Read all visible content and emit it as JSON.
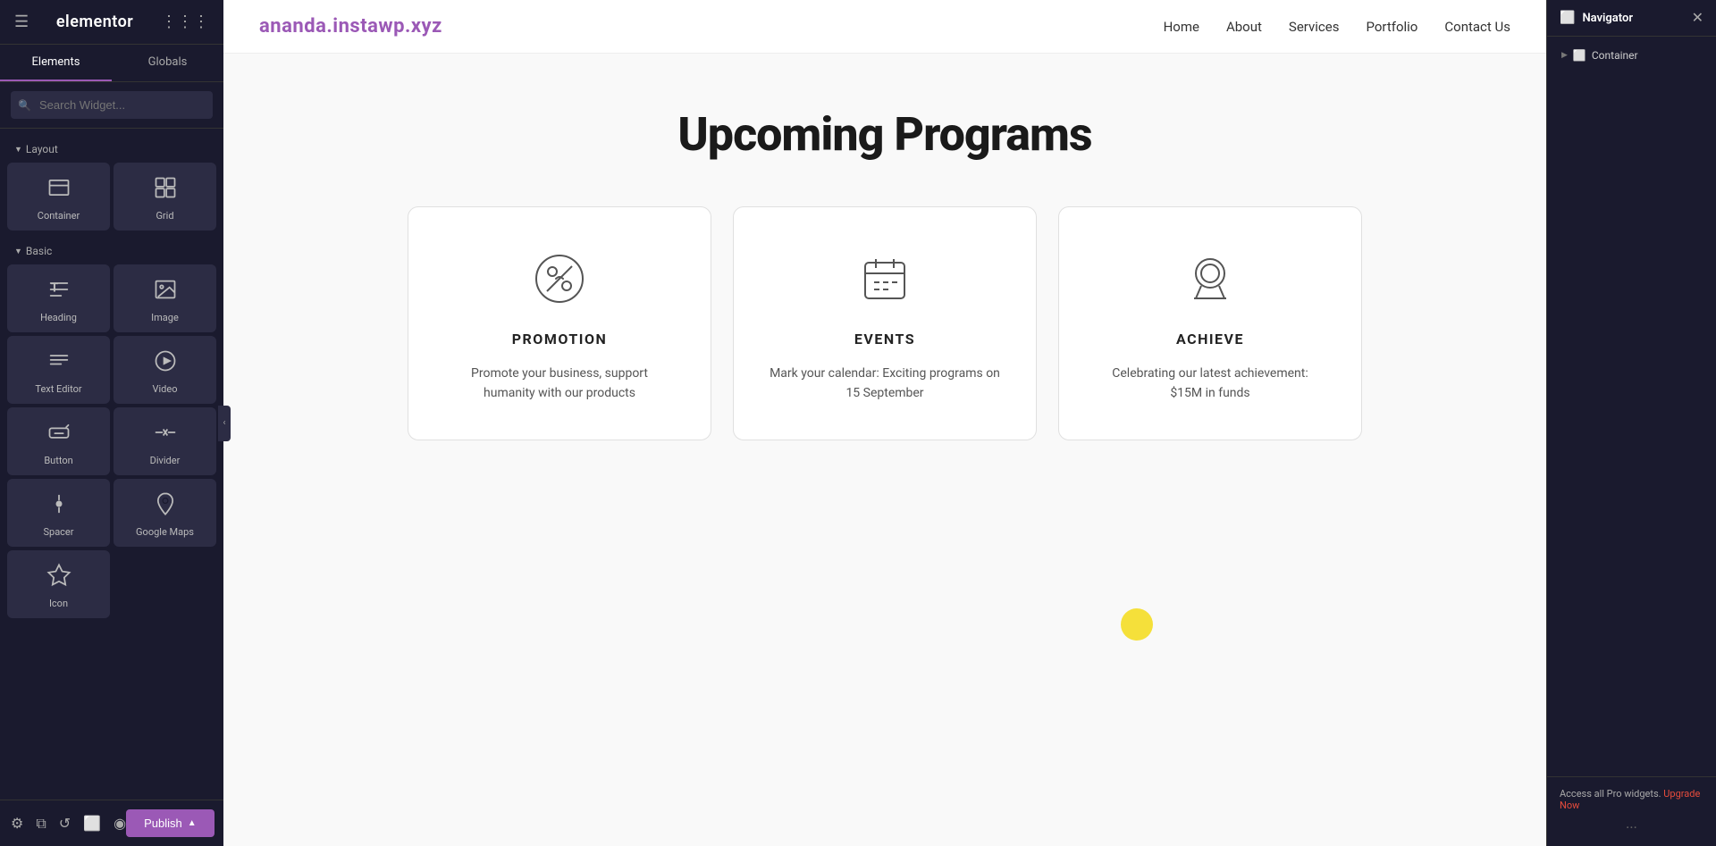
{
  "app": {
    "name": "elementor",
    "logo_text": "elementor"
  },
  "sidebar": {
    "tabs": [
      {
        "label": "Elements",
        "active": true
      },
      {
        "label": "Globals",
        "active": false
      }
    ],
    "search_placeholder": "Search Widget...",
    "sections": {
      "layout": {
        "label": "Layout",
        "widgets": [
          {
            "id": "container",
            "label": "Container",
            "icon": "container"
          },
          {
            "id": "grid",
            "label": "Grid",
            "icon": "grid"
          }
        ]
      },
      "basic": {
        "label": "Basic",
        "widgets": [
          {
            "id": "heading",
            "label": "Heading",
            "icon": "heading"
          },
          {
            "id": "image",
            "label": "Image",
            "icon": "image"
          },
          {
            "id": "text-editor",
            "label": "Text Editor",
            "icon": "text-editor"
          },
          {
            "id": "video",
            "label": "Video",
            "icon": "video"
          },
          {
            "id": "button",
            "label": "Button",
            "icon": "button"
          },
          {
            "id": "divider",
            "label": "Divider",
            "icon": "divider"
          },
          {
            "id": "spacer",
            "label": "Spacer",
            "icon": "spacer"
          },
          {
            "id": "google-maps",
            "label": "Google Maps",
            "icon": "google-maps"
          },
          {
            "id": "icon",
            "label": "Icon",
            "icon": "icon"
          }
        ]
      }
    },
    "footer": {
      "upgrade_notice": "Access all Pro widgets.",
      "upgrade_link": "Upgrade Now",
      "upgrade_button": "Upgrade"
    }
  },
  "bottom_bar": {
    "publish_label": "Publish"
  },
  "navigator": {
    "title": "Navigator",
    "tree_item": "Container",
    "footer_notice": "Access all Pro widgets.",
    "footer_upgrade": "Upgrade Now",
    "dots": "..."
  },
  "page": {
    "nav": {
      "logo": "ananda.instawp.xyz",
      "links": [
        "Home",
        "About",
        "Services",
        "Portfolio",
        "Contact Us"
      ]
    },
    "section_title": "Upcoming Programs",
    "cards": [
      {
        "id": "promotion",
        "title": "PROMOTION",
        "description": "Promote your business, support humanity with our products",
        "icon": "percent"
      },
      {
        "id": "events",
        "title": "EVENTS",
        "description": "Mark your calendar: Exciting programs on 15 September",
        "icon": "calendar"
      },
      {
        "id": "achieve",
        "title": "ACHIEVE",
        "description": "Celebrating our latest achievement: $15M in funds",
        "icon": "medal"
      }
    ]
  }
}
